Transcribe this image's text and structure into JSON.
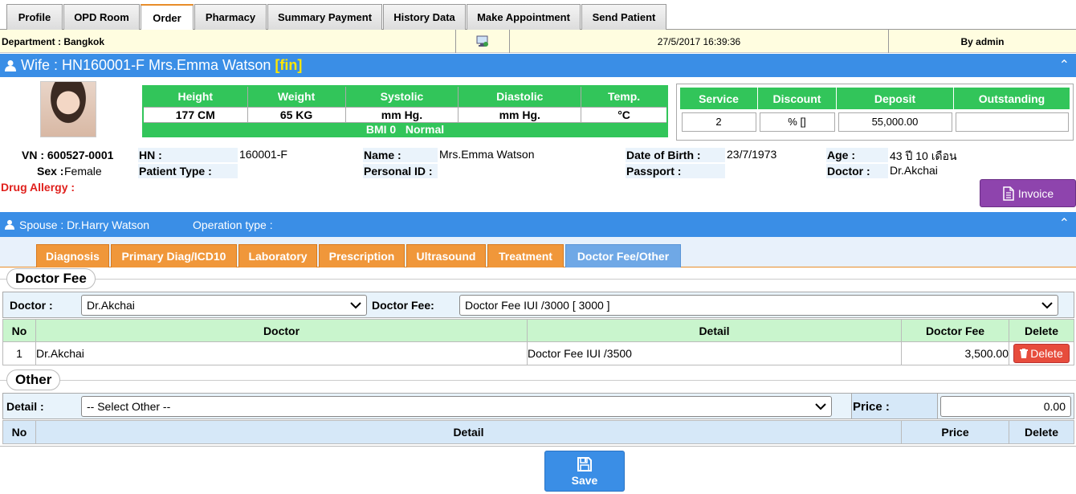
{
  "tabs": [
    "Profile",
    "OPD Room",
    "Order",
    "Pharmacy",
    "Summary Payment",
    "History Data",
    "Make Appointment",
    "Send Patient"
  ],
  "active_tab": "Order",
  "infobar": {
    "department": "Department : Bangkok",
    "datetime": "27/5/2017 16:39:36",
    "user": "By admin"
  },
  "wife_header": {
    "prefix": "Wife : HN160001-F Mrs.Emma Watson ",
    "status": "[fin]"
  },
  "vitals": {
    "headers": [
      "Height",
      "Weight",
      "Systolic",
      "Diastolic",
      "Temp."
    ],
    "values": [
      "177 CM",
      "65 KG",
      "mm Hg.",
      "mm Hg.",
      "°C"
    ],
    "bmi": "BMI 0   Normal"
  },
  "finance": {
    "headers": [
      "Service",
      "Discount",
      "Deposit",
      "Outstanding"
    ],
    "values": [
      "2",
      "% []",
      "55,000.00",
      ""
    ]
  },
  "patient": {
    "vn": "VN : 600527-0001",
    "sex_label": "Sex :",
    "sex_value": "Female",
    "drug_allergy": "Drug Allergy :",
    "hn_label": "HN :",
    "hn_value": "160001-F",
    "patient_type_label": "Patient Type :",
    "name_label": "Name :",
    "name_value": "Mrs.Emma Watson",
    "personal_id_label": "Personal ID :",
    "dob_label": "Date of Birth :",
    "dob_value": "23/7/1973",
    "passport_label": "Passport :",
    "age_label": "Age :",
    "age_value": "43 ปี 10 เดือน",
    "doctor_label": "Doctor :",
    "doctor_value": "Dr.Akchai"
  },
  "invoice_button": "Invoice",
  "spouse_header": {
    "spouse": "Spouse : Dr.Harry Watson",
    "operation": "Operation type :"
  },
  "subtabs": [
    "Diagnosis",
    "Primary Diag/ICD10",
    "Laboratory",
    "Prescription",
    "Ultrasound",
    "Treatment",
    "Doctor Fee/Other"
  ],
  "active_subtab": "Doctor Fee/Other",
  "doctor_fee": {
    "title": "Doctor Fee",
    "doctor_label": "Doctor :",
    "doctor_selected": "Dr.Akchai",
    "fee_label": "Doctor Fee:",
    "fee_selected": "Doctor Fee IUI /3000 [ 3000 ]",
    "columns": [
      "No",
      "Doctor",
      "Detail",
      "Doctor Fee",
      "Delete"
    ],
    "rows": [
      {
        "no": "1",
        "doctor": "Dr.Akchai",
        "detail": "Doctor Fee IUI /3500",
        "fee": "3,500.00",
        "delete": "Delete"
      }
    ]
  },
  "other": {
    "title": "Other",
    "detail_label": "Detail :",
    "detail_selected": "-- Select Other --",
    "price_label": "Price :",
    "price_value": "0.00",
    "columns": [
      "No",
      "Detail",
      "Price",
      "Delete"
    ]
  },
  "save_button": "Save",
  "colors": {
    "header_blue": "#3a8ee6",
    "vitals_green": "#32c55a",
    "tab_orange": "#f0973a",
    "invoice_purple": "#8e44ad",
    "delete_red": "#e74c3c",
    "fin_yellow": "#ffe600"
  }
}
